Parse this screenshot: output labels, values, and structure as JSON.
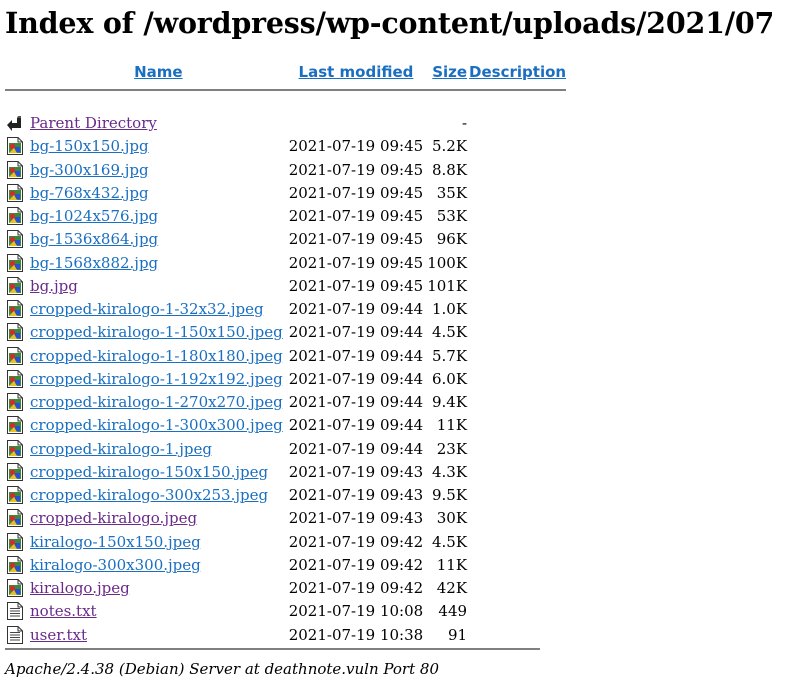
{
  "title": "Index of /wordpress/wp-content/uploads/2021/07",
  "columns": {
    "name": "Name",
    "last_modified": "Last modified",
    "size": "Size",
    "description": "Description"
  },
  "parent": {
    "label": "Parent Directory",
    "modified": "",
    "size": "-"
  },
  "files": [
    {
      "name": "bg-150x150.jpg",
      "modified": "2021-07-19 09:45",
      "size": "5.2K",
      "type": "image",
      "visited": false
    },
    {
      "name": "bg-300x169.jpg",
      "modified": "2021-07-19 09:45",
      "size": "8.8K",
      "type": "image",
      "visited": false
    },
    {
      "name": "bg-768x432.jpg",
      "modified": "2021-07-19 09:45",
      "size": "35K",
      "type": "image",
      "visited": false
    },
    {
      "name": "bg-1024x576.jpg",
      "modified": "2021-07-19 09:45",
      "size": "53K",
      "type": "image",
      "visited": false
    },
    {
      "name": "bg-1536x864.jpg",
      "modified": "2021-07-19 09:45",
      "size": "96K",
      "type": "image",
      "visited": false
    },
    {
      "name": "bg-1568x882.jpg",
      "modified": "2021-07-19 09:45",
      "size": "100K",
      "type": "image",
      "visited": false
    },
    {
      "name": "bg.jpg",
      "modified": "2021-07-19 09:45",
      "size": "101K",
      "type": "image",
      "visited": true
    },
    {
      "name": "cropped-kiralogo-1-32x32.jpeg",
      "modified": "2021-07-19 09:44",
      "size": "1.0K",
      "type": "image",
      "visited": false
    },
    {
      "name": "cropped-kiralogo-1-150x150.jpeg",
      "modified": "2021-07-19 09:44",
      "size": "4.5K",
      "type": "image",
      "visited": false
    },
    {
      "name": "cropped-kiralogo-1-180x180.jpeg",
      "modified": "2021-07-19 09:44",
      "size": "5.7K",
      "type": "image",
      "visited": false
    },
    {
      "name": "cropped-kiralogo-1-192x192.jpeg",
      "modified": "2021-07-19 09:44",
      "size": "6.0K",
      "type": "image",
      "visited": false
    },
    {
      "name": "cropped-kiralogo-1-270x270.jpeg",
      "modified": "2021-07-19 09:44",
      "size": "9.4K",
      "type": "image",
      "visited": false
    },
    {
      "name": "cropped-kiralogo-1-300x300.jpeg",
      "modified": "2021-07-19 09:44",
      "size": "11K",
      "type": "image",
      "visited": false
    },
    {
      "name": "cropped-kiralogo-1.jpeg",
      "modified": "2021-07-19 09:44",
      "size": "23K",
      "type": "image",
      "visited": false
    },
    {
      "name": "cropped-kiralogo-150x150.jpeg",
      "modified": "2021-07-19 09:43",
      "size": "4.3K",
      "type": "image",
      "visited": false
    },
    {
      "name": "cropped-kiralogo-300x253.jpeg",
      "modified": "2021-07-19 09:43",
      "size": "9.5K",
      "type": "image",
      "visited": false
    },
    {
      "name": "cropped-kiralogo.jpeg",
      "modified": "2021-07-19 09:43",
      "size": "30K",
      "type": "image",
      "visited": true
    },
    {
      "name": "kiralogo-150x150.jpeg",
      "modified": "2021-07-19 09:42",
      "size": "4.5K",
      "type": "image",
      "visited": false
    },
    {
      "name": "kiralogo-300x300.jpeg",
      "modified": "2021-07-19 09:42",
      "size": "11K",
      "type": "image",
      "visited": false
    },
    {
      "name": "kiralogo.jpeg",
      "modified": "2021-07-19 09:42",
      "size": "42K",
      "type": "image",
      "visited": true
    },
    {
      "name": "notes.txt",
      "modified": "2021-07-19 10:08",
      "size": "449",
      "type": "text",
      "visited": true
    },
    {
      "name": "user.txt",
      "modified": "2021-07-19 10:38",
      "size": "91",
      "type": "text",
      "visited": true
    }
  ],
  "footer": "Apache/2.4.38 (Debian) Server at deathnote.vuln Port 80",
  "colors": {
    "link": "#1a6fc0",
    "visited": "#6a2a8a",
    "rule": "#808080"
  }
}
